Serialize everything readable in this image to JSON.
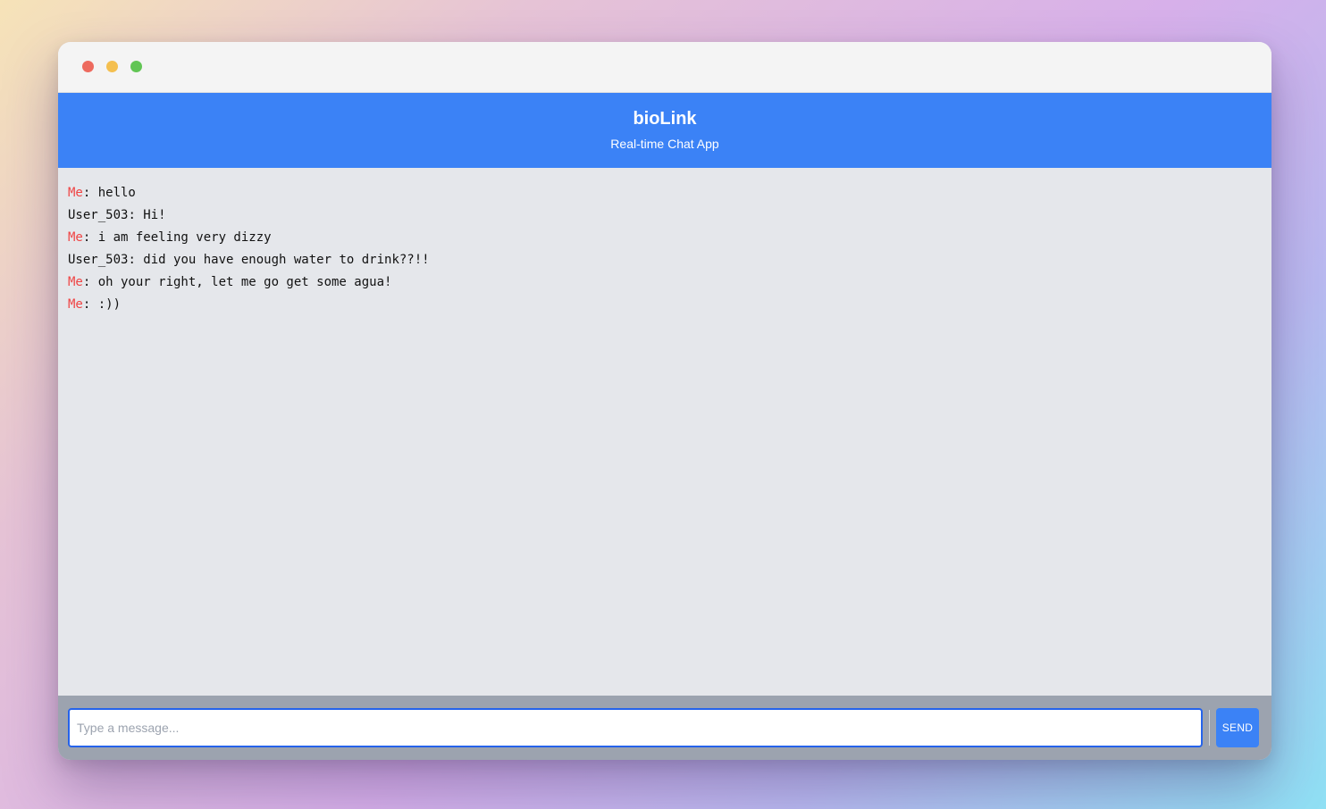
{
  "app": {
    "title": "bioLink",
    "subtitle": "Real-time Chat App"
  },
  "messages": [
    {
      "sender": "Me",
      "text": ": hello",
      "is_me": true
    },
    {
      "sender": "User_503",
      "text": ": Hi!",
      "is_me": false
    },
    {
      "sender": "Me",
      "text": ": i am feeling very dizzy",
      "is_me": true
    },
    {
      "sender": "User_503",
      "text": ": did you have enough water to drink??!!",
      "is_me": false
    },
    {
      "sender": "Me",
      "text": ": oh your right, let me go get some agua!",
      "is_me": true
    },
    {
      "sender": "Me",
      "text": ": :))",
      "is_me": true
    }
  ],
  "composer": {
    "placeholder": "Type a message...",
    "value": "",
    "send_label": "SEND"
  },
  "colors": {
    "header": "#3b82f6",
    "me_sender": "#ef4444",
    "messages_bg": "#e5e7eb",
    "composer_bg": "#9ca3af"
  }
}
